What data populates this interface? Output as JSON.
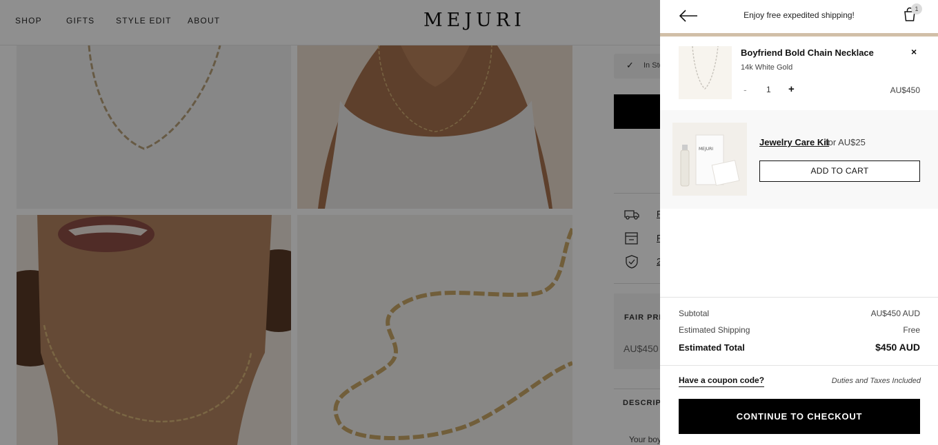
{
  "nav": {
    "links": [
      "SHOP",
      "GIFTS",
      "STYLE EDIT",
      "ABOUT"
    ],
    "logo": "MEJURI"
  },
  "product_page": {
    "stock_text": "In Stock",
    "fair_price_label": "FAIR PRICE",
    "fair_price_value": "AU$450",
    "description_label": "DESCRIPTION",
    "description_snippet": "Your boy"
  },
  "cart": {
    "shipping_message": "Enjoy free expedited shipping!",
    "bag_count": "1",
    "shipping_progress": 1.0,
    "accent_color": "#d1bfa7",
    "item": {
      "title": "Boyfriend Bold Chain Necklace",
      "variant": "14k White Gold",
      "quantity": "1",
      "minus": "-",
      "plus": "+",
      "price": "AU$450",
      "remove": "×"
    },
    "upsell": {
      "name": "Jewelry Care Kit",
      "for_price": "for AU$25",
      "button": "ADD TO CART"
    },
    "summary": {
      "subtotal_label": "Subtotal",
      "subtotal_value": "AU$450 AUD",
      "shipping_label": "Estimated Shipping",
      "shipping_value": "Free",
      "total_label": "Estimated Total",
      "total_value": "$450 AUD"
    },
    "coupon_label": "Have a coupon code?",
    "duties_note": "Duties and Taxes Included",
    "checkout_button": "CONTINUE TO CHECKOUT"
  },
  "icons": [
    "back-arrow-icon",
    "shopping-bag-icon",
    "close-icon",
    "truck-icon",
    "box-icon",
    "shield-icon",
    "check-icon"
  ]
}
